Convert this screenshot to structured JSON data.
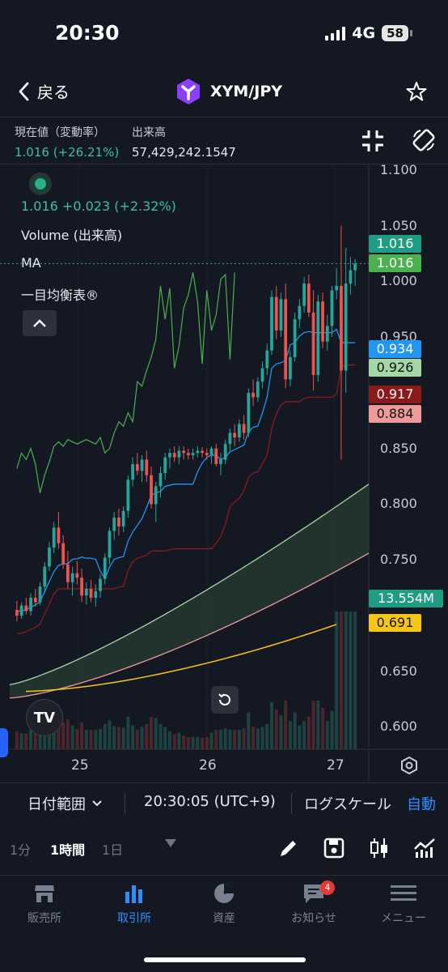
{
  "status": {
    "time": "20:30",
    "network": "4G",
    "battery": "58"
  },
  "nav": {
    "back_label": "戻る",
    "pair": "XYM/JPY",
    "brand_color": "#8a3ffc"
  },
  "info": {
    "current_label": "現在値（変動率）",
    "current_value": "1.016 (+26.21%)",
    "volume_label": "出来高",
    "volume_value": "57,429,242.1547"
  },
  "chart": {
    "legend_price": "1.016",
    "legend_change": "+0.023 (+2.32%)",
    "indicator_volume": "Volume (出来高)",
    "indicator_ma": "MA",
    "indicator_ichimoku": "一目均衡表®",
    "logo_text": "TV",
    "y_axis_ticks": [
      "1.100",
      "1.050",
      "1.000",
      "0.950",
      "0.850",
      "0.800",
      "0.750",
      "0.650",
      "0.600"
    ],
    "price_tags": [
      {
        "value": "1.016",
        "bg": "#1f9c83",
        "fg": "#ffffff"
      },
      {
        "value": "1.016",
        "bg": "#4caf50",
        "fg": "#ffffff"
      },
      {
        "value": "0.934",
        "bg": "#2196f3",
        "fg": "#ffffff"
      },
      {
        "value": "0.926",
        "bg": "#a5d6a7",
        "fg": "#111111"
      },
      {
        "value": "0.917",
        "bg": "#8b1a1a",
        "fg": "#ffffff"
      },
      {
        "value": "0.884",
        "bg": "#ef9a9a",
        "fg": "#111111"
      },
      {
        "value": "13.554M",
        "bg": "#1f9c83",
        "fg": "#ffffff"
      },
      {
        "value": "0.691",
        "bg": "#f5c518",
        "fg": "#111111"
      }
    ],
    "x_axis_ticks": [
      "25",
      "26",
      "27"
    ],
    "colors": {
      "up": "#26a69a",
      "down": "#ef5350",
      "tenkan": "#2196f3",
      "kijun": "#8b1a1a",
      "chikou": "#4caf50",
      "senkou_a": "#a5d6a7",
      "senkou_b": "#ef9a9a",
      "ma": "#f5c518"
    }
  },
  "chart_data": {
    "type": "candlestick",
    "y_range": [
      0.58,
      1.105
    ],
    "y_scale": "linear",
    "candle_count": 74,
    "last_price": 1.016,
    "ohlc": [
      [
        0.705,
        0.713,
        0.695,
        0.7
      ],
      [
        0.7,
        0.712,
        0.697,
        0.709
      ],
      [
        0.709,
        0.716,
        0.701,
        0.704
      ],
      [
        0.704,
        0.72,
        0.7,
        0.716
      ],
      [
        0.716,
        0.724,
        0.708,
        0.712
      ],
      [
        0.712,
        0.73,
        0.709,
        0.726
      ],
      [
        0.726,
        0.748,
        0.72,
        0.744
      ],
      [
        0.744,
        0.766,
        0.74,
        0.761
      ],
      [
        0.761,
        0.784,
        0.756,
        0.779
      ],
      [
        0.779,
        0.793,
        0.76,
        0.765
      ],
      [
        0.765,
        0.772,
        0.742,
        0.746
      ],
      [
        0.746,
        0.758,
        0.724,
        0.73
      ],
      [
        0.73,
        0.744,
        0.718,
        0.738
      ],
      [
        0.738,
        0.749,
        0.728,
        0.734
      ],
      [
        0.734,
        0.742,
        0.712,
        0.718
      ],
      [
        0.718,
        0.73,
        0.71,
        0.724
      ],
      [
        0.724,
        0.732,
        0.712,
        0.716
      ],
      [
        0.716,
        0.728,
        0.708,
        0.722
      ],
      [
        0.722,
        0.737,
        0.716,
        0.733
      ],
      [
        0.733,
        0.756,
        0.728,
        0.752
      ],
      [
        0.752,
        0.779,
        0.746,
        0.776
      ],
      [
        0.776,
        0.793,
        0.768,
        0.788
      ],
      [
        0.788,
        0.796,
        0.772,
        0.78
      ],
      [
        0.78,
        0.798,
        0.775,
        0.794
      ],
      [
        0.794,
        0.826,
        0.788,
        0.822
      ],
      [
        0.822,
        0.842,
        0.816,
        0.836
      ],
      [
        0.836,
        0.846,
        0.826,
        0.83
      ],
      [
        0.83,
        0.844,
        0.82,
        0.84
      ],
      [
        0.84,
        0.848,
        0.82,
        0.826
      ],
      [
        0.826,
        0.834,
        0.796,
        0.8
      ],
      [
        0.8,
        0.82,
        0.784,
        0.816
      ],
      [
        0.816,
        0.834,
        0.806,
        0.828
      ],
      [
        0.828,
        0.846,
        0.822,
        0.842
      ],
      [
        0.842,
        0.85,
        0.832,
        0.846
      ],
      [
        0.846,
        0.852,
        0.838,
        0.842
      ],
      [
        0.842,
        0.852,
        0.836,
        0.848
      ],
      [
        0.848,
        0.852,
        0.84,
        0.846
      ],
      [
        0.846,
        0.85,
        0.84,
        0.844
      ],
      [
        0.844,
        0.85,
        0.84,
        0.846
      ],
      [
        0.846,
        0.852,
        0.842,
        0.848
      ],
      [
        0.848,
        0.851,
        0.842,
        0.846
      ],
      [
        0.846,
        0.85,
        0.84,
        0.844
      ],
      [
        0.844,
        0.852,
        0.836,
        0.85
      ],
      [
        0.85,
        0.854,
        0.834,
        0.836
      ],
      [
        0.836,
        0.846,
        0.826,
        0.84
      ],
      [
        0.84,
        0.858,
        0.836,
        0.854
      ],
      [
        0.854,
        0.868,
        0.848,
        0.864
      ],
      [
        0.864,
        0.872,
        0.852,
        0.86
      ],
      [
        0.86,
        0.876,
        0.856,
        0.872
      ],
      [
        0.872,
        0.88,
        0.858,
        0.864
      ],
      [
        0.864,
        0.904,
        0.86,
        0.9
      ],
      [
        0.9,
        0.912,
        0.888,
        0.896
      ],
      [
        0.896,
        0.914,
        0.892,
        0.91
      ],
      [
        0.91,
        0.928,
        0.904,
        0.922
      ],
      [
        0.922,
        0.944,
        0.916,
        0.938
      ],
      [
        0.938,
        0.992,
        0.934,
        0.986
      ],
      [
        0.986,
        0.996,
        0.948,
        0.956
      ],
      [
        0.956,
        0.99,
        0.95,
        0.984
      ],
      [
        0.984,
        0.998,
        0.904,
        0.912
      ],
      [
        0.912,
        0.938,
        0.906,
        0.932
      ],
      [
        0.932,
        0.972,
        0.928,
        0.966
      ],
      [
        0.966,
        0.984,
        0.958,
        0.978
      ],
      [
        0.978,
        1.004,
        0.972,
        0.998
      ],
      [
        0.998,
        1.006,
        0.968,
        0.972
      ],
      [
        0.972,
        0.992,
        0.902,
        0.916
      ],
      [
        0.916,
        0.988,
        0.91,
        0.982
      ],
      [
        0.982,
        0.99,
        0.94,
        0.946
      ],
      [
        0.946,
        0.97,
        0.938,
        0.96
      ],
      [
        0.96,
        0.996,
        0.95,
        0.992
      ],
      [
        0.992,
        1.012,
        0.984,
        0.996
      ],
      [
        0.996,
        1.05,
        0.84,
        0.92
      ],
      [
        0.92,
        1.03,
        0.9,
        0.998
      ],
      [
        0.998,
        1.022,
        0.988,
        1.01
      ],
      [
        1.01,
        1.02,
        0.996,
        1.016
      ]
    ]
  },
  "range_bar": {
    "date_range_label": "日付範囲",
    "time_label": "20:30:05 (UTC+9)",
    "log_scale_label": "ログスケール",
    "auto_label": "自動"
  },
  "intervals": {
    "items": [
      "1分",
      "1時間",
      "1日"
    ],
    "active": "1時間"
  },
  "tabs": {
    "items": [
      "販売所",
      "取引所",
      "資産",
      "お知らせ",
      "メニュー"
    ],
    "notification_count": "4",
    "active_color": "#2f8fff"
  }
}
